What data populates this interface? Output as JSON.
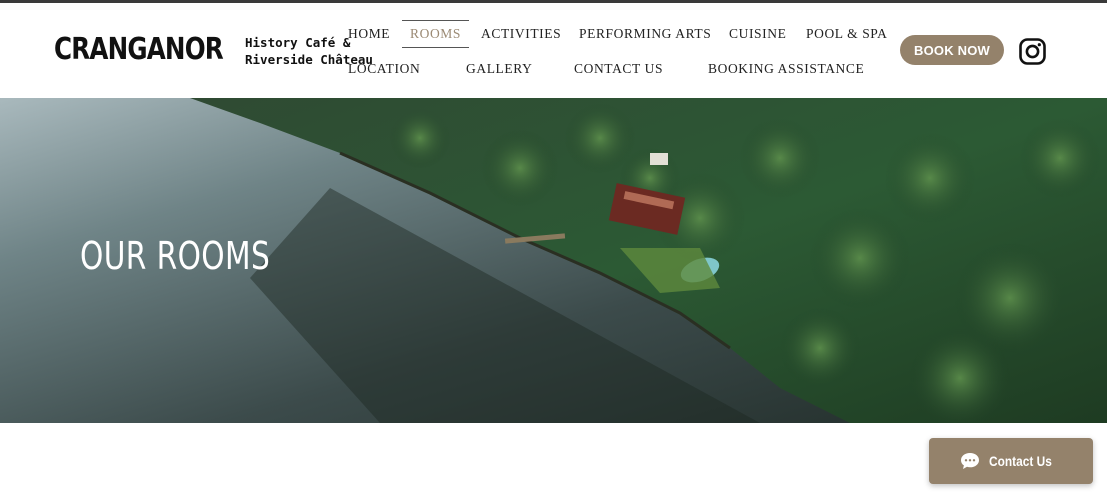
{
  "brand": {
    "name": "CRANGANOR",
    "tagline_line1": "History Café &",
    "tagline_line2": "Riverside Château"
  },
  "nav": {
    "row1": [
      "HOME",
      "ROOMS",
      "ACTIVITIES",
      "PERFORMING ARTS",
      "CUISINE",
      "POOL & SPA"
    ],
    "row2": [
      "LOCATION",
      "GALLERY",
      "CONTACT US",
      "BOOKING ASSISTANCE"
    ],
    "active": "ROOMS"
  },
  "book_now_label": "BOOK NOW",
  "social_icon": "instagram-icon",
  "hero": {
    "title": "OUR ROOMS"
  },
  "chat": {
    "label": "Contact Us",
    "icon": "chat-bubble-icon"
  },
  "colors": {
    "accent": "#94826b",
    "active_nav": "#9b8a74",
    "text": "#222222"
  }
}
